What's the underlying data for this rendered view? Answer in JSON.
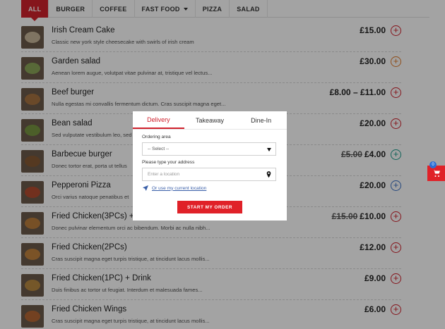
{
  "tabs": [
    {
      "label": "ALL",
      "active": true
    },
    {
      "label": "BURGER"
    },
    {
      "label": "COFFEE"
    },
    {
      "label": "FAST FOOD",
      "has_dropdown": true
    },
    {
      "label": "PIZZA"
    },
    {
      "label": "SALAD"
    }
  ],
  "items": [
    {
      "name": "Irish Cream Cake",
      "desc": "Classic new york style cheesecake with swirls of irish cream",
      "price": "£15.00",
      "old_price": "",
      "add_color": "red"
    },
    {
      "name": "Garden salad",
      "desc": "Aenean lorem augue, volutpat vitae pulvinar at, tristique vel lectus...",
      "price": "£30.00",
      "old_price": "",
      "add_color": "orange"
    },
    {
      "name": "Beef burger",
      "desc": "Nulla egestas mi convallis fermentum dictum. Cras suscipit magna eget...",
      "price": "£8.00 – £11.00",
      "old_price": "",
      "add_color": "red"
    },
    {
      "name": "Bean salad",
      "desc": "Sed vulputate vestibulum leo, sed",
      "price": "£20.00",
      "old_price": "",
      "add_color": "red"
    },
    {
      "name": "Barbecue burger",
      "desc": "Donec tortor erat, porta ut tellus",
      "price": "£4.00",
      "old_price": "£5.00",
      "add_color": "teal"
    },
    {
      "name": "Pepperoni Pizza",
      "desc": "Orci varius natoque penatibus et",
      "price": "£20.00",
      "old_price": "",
      "add_color": "blue"
    },
    {
      "name": "Fried Chicken(3PCs) + Drink",
      "desc": "Donec pulvinar elementum orci ac bibendum. Morbi ac nulla nibh...",
      "price": "£10.00",
      "old_price": "£15.00",
      "add_color": "red"
    },
    {
      "name": "Fried Chicken(2PCs)",
      "desc": "Cras suscipit magna eget turpis tristique, at tincidunt lacus mollis...",
      "price": "£12.00",
      "old_price": "",
      "add_color": "red"
    },
    {
      "name": "Fried Chicken(1PC) + Drink",
      "desc": "Duis finibus ac tortor ut feugiat. Interdum et malesuada fames...",
      "price": "£9.00",
      "old_price": "",
      "add_color": "red"
    },
    {
      "name": "Fried Chicken Wings",
      "desc": "Cras suscipit magna eget turpis tristique, at tincidunt lacus mollis...",
      "price": "£6.00",
      "old_price": "",
      "add_color": "red"
    }
  ],
  "add_symbol": "+",
  "cart": {
    "count": "0"
  },
  "modal": {
    "tabs": [
      {
        "label": "Delivery",
        "active": true
      },
      {
        "label": "Takeaway"
      },
      {
        "label": "Dine-In"
      }
    ],
    "ordering_area_label": "Ordering area",
    "select_value": "-- Select --",
    "address_label": "Please type your address",
    "address_placeholder": "Enter a location",
    "current_location_link": "Or use my current location",
    "start_button": "START MY ORDER"
  }
}
